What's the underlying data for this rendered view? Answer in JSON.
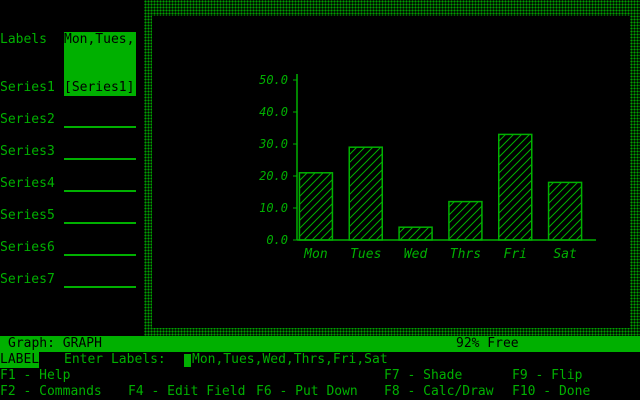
{
  "left_panel": {
    "labels_label": "Labels",
    "labels_value": "Mon,Tues,",
    "series": [
      {
        "label": "Series1",
        "value": "[Series1]"
      },
      {
        "label": "Series2",
        "value": ""
      },
      {
        "label": "Series3",
        "value": ""
      },
      {
        "label": "Series4",
        "value": ""
      },
      {
        "label": "Series5",
        "value": ""
      },
      {
        "label": "Series6",
        "value": ""
      },
      {
        "label": "Series7",
        "value": ""
      }
    ]
  },
  "chart_data": {
    "type": "bar",
    "categories": [
      "Mon",
      "Tues",
      "Wed",
      "Thrs",
      "Fri",
      "Sat"
    ],
    "values": [
      21,
      29,
      4,
      12,
      33,
      18
    ],
    "ylim": [
      0,
      50
    ],
    "yticks": [
      "50.0",
      "40.0",
      "30.0",
      "20.0",
      "10.0",
      "0.0"
    ],
    "fill": "diagonal-hatch",
    "grid": false,
    "colors": {
      "bars": "#00b000",
      "axis": "#00b000",
      "text": "#00b000"
    }
  },
  "status": {
    "graph_label": "Graph: GRAPH",
    "free": "92% Free"
  },
  "prompt": {
    "mode": "LABEL",
    "text": "Enter Labels:",
    "value": "Mon,Tues,Wed,Thrs,Fri,Sat"
  },
  "help_keys": {
    "f1": "F1 - Help",
    "f7": "F7 - Shade",
    "f9": "F9 - Flip",
    "f2": "F2 - Commands",
    "f4": "F4 - Edit Field",
    "f6": "F6 - Put Down",
    "f8": "F8 - Calc/Draw",
    "f10": "F10 - Done"
  },
  "colors": {
    "fg": "#00b000",
    "bg": "#000000"
  }
}
